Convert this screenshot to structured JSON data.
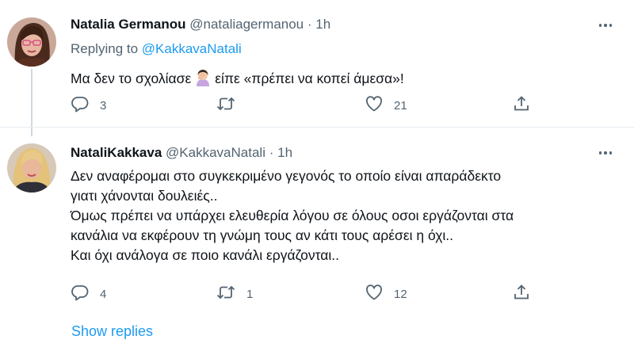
{
  "tweets": [
    {
      "display_name": "Natalia Germanou",
      "handle": "@nataliagermanou",
      "separator": "·",
      "time": "1h",
      "replying_prefix": "Replying to",
      "replying_to": "@KakkavaNatali",
      "text_before_emoji": "Μα δεν το σχολίασε",
      "emoji": "woman-facepalming",
      "text_after_emoji": "είπε «πρέπει να κοπεί άμεσα»!",
      "stats": {
        "replies": "3",
        "retweets": "",
        "likes": "21"
      }
    },
    {
      "display_name": "NataliKakkava",
      "handle": "@KakkavaNatali",
      "separator": "·",
      "time": "1h",
      "text": "Δεν αναφέρομαι στο συγκεκριμένο γεγονός το οποίο είναι απαράδεκτο\nγιατι χάνονται δουλειές..\nΌμως πρέπει να υπάρχει ελευθερία λόγου σε όλους οσοι εργάζονται στα\nκανάλια να εκφέρουν τη γνώμη τους αν κάτι τους αρέσει η όχι..\nΚαι όχι ανάλογα σε ποιο κανάλι εργάζονται..",
      "stats": {
        "replies": "4",
        "retweets": "1",
        "likes": "12"
      }
    }
  ],
  "show_replies": "Show replies",
  "colors": {
    "accent": "#1d9bf0",
    "secondary_text": "#536471",
    "divider": "#e6ecf0"
  }
}
